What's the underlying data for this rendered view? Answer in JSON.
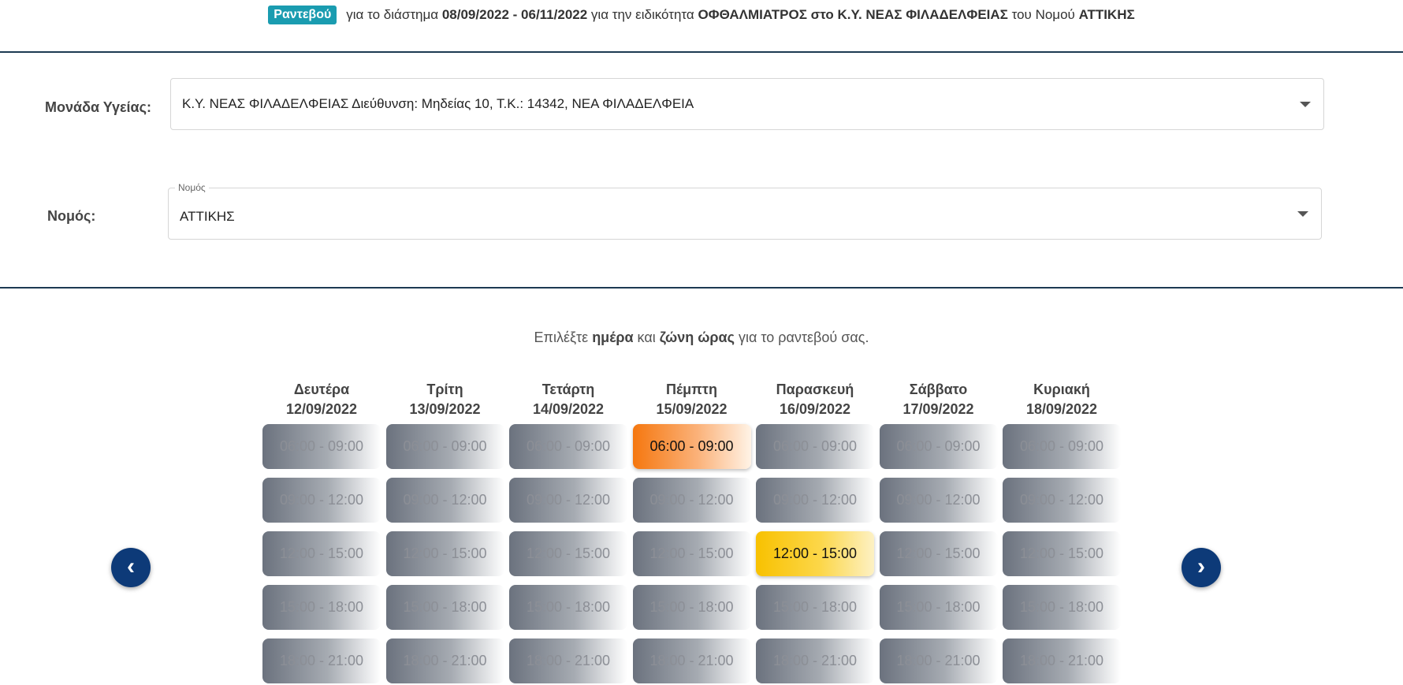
{
  "header": {
    "badge": "Ραντεβού",
    "t1": "για το διάστημα ",
    "period": "08/09/2022 - 06/11/2022",
    "t2": " για την ειδικότητα ",
    "specialty": "ΟΦΘΑΛΜΙΑΤΡΟΣ στο Κ.Υ. ΝΕΑΣ ΦΙΛΑΔΕΛΦΕΙΑΣ",
    "t3": " του Νομού ",
    "prefecture": "ΑΤΤΙΚΗΣ"
  },
  "form": {
    "unit_label": "Μονάδα Υγείας:",
    "unit_value": "Κ.Υ. ΝΕΑΣ ΦΙΛΑΔΕΛΦΕΙΑΣ Διεύθυνση: Μηδείας 10, Τ.Κ.: 14342, ΝΕΑ ΦΙΛΑΔΕΛΦΕΙΑ",
    "prefecture_label": "Νομός:",
    "prefecture_float_label": "Νομός",
    "prefecture_value": "ΑΤΤΙΚΗΣ"
  },
  "instructions": {
    "p1": "Επιλέξτε ",
    "day": "ημέρα",
    "p2": " και ",
    "zone": "ζώνη ώρας",
    "p3": " για το ραντεβού σας."
  },
  "nav": {
    "prev_icon": "chevron-left-icon",
    "next_icon": "chevron-right-icon",
    "prev": "‹",
    "next": "›"
  },
  "colors": {
    "accent": "#1a9cb0",
    "nav": "#0d3a78",
    "available": "#f5770f",
    "selected": "#f8c100",
    "divider": "#1d3a52"
  },
  "days": [
    {
      "name": "Δευτέρα",
      "date": "12/09/2022",
      "slots": [
        {
          "label": "06:00 - 09:00",
          "state": "unavailable"
        },
        {
          "label": "09:00 - 12:00",
          "state": "unavailable"
        },
        {
          "label": "12:00 - 15:00",
          "state": "unavailable"
        },
        {
          "label": "15:00 - 18:00",
          "state": "unavailable"
        },
        {
          "label": "18:00 - 21:00",
          "state": "unavailable"
        }
      ]
    },
    {
      "name": "Τρίτη",
      "date": "13/09/2022",
      "slots": [
        {
          "label": "06:00 - 09:00",
          "state": "unavailable"
        },
        {
          "label": "09:00 - 12:00",
          "state": "unavailable"
        },
        {
          "label": "12:00 - 15:00",
          "state": "unavailable"
        },
        {
          "label": "15:00 - 18:00",
          "state": "unavailable"
        },
        {
          "label": "18:00 - 21:00",
          "state": "unavailable"
        }
      ]
    },
    {
      "name": "Τετάρτη",
      "date": "14/09/2022",
      "slots": [
        {
          "label": "06:00 - 09:00",
          "state": "unavailable"
        },
        {
          "label": "09:00 - 12:00",
          "state": "unavailable"
        },
        {
          "label": "12:00 - 15:00",
          "state": "unavailable"
        },
        {
          "label": "15:00 - 18:00",
          "state": "unavailable"
        },
        {
          "label": "18:00 - 21:00",
          "state": "unavailable"
        }
      ]
    },
    {
      "name": "Πέμπτη",
      "date": "15/09/2022",
      "slots": [
        {
          "label": "06:00 - 09:00",
          "state": "orange"
        },
        {
          "label": "09:00 - 12:00",
          "state": "unavailable"
        },
        {
          "label": "12:00 - 15:00",
          "state": "unavailable"
        },
        {
          "label": "15:00 - 18:00",
          "state": "unavailable"
        },
        {
          "label": "18:00 - 21:00",
          "state": "unavailable"
        }
      ]
    },
    {
      "name": "Παρασκευή",
      "date": "16/09/2022",
      "slots": [
        {
          "label": "06:00 - 09:00",
          "state": "unavailable"
        },
        {
          "label": "09:00 - 12:00",
          "state": "unavailable"
        },
        {
          "label": "12:00 - 15:00",
          "state": "yellow"
        },
        {
          "label": "15:00 - 18:00",
          "state": "unavailable"
        },
        {
          "label": "18:00 - 21:00",
          "state": "unavailable"
        }
      ]
    },
    {
      "name": "Σάββατο",
      "date": "17/09/2022",
      "slots": [
        {
          "label": "06:00 - 09:00",
          "state": "unavailable"
        },
        {
          "label": "09:00 - 12:00",
          "state": "unavailable"
        },
        {
          "label": "12:00 - 15:00",
          "state": "unavailable"
        },
        {
          "label": "15:00 - 18:00",
          "state": "unavailable"
        },
        {
          "label": "18:00 - 21:00",
          "state": "unavailable"
        }
      ]
    },
    {
      "name": "Κυριακή",
      "date": "18/09/2022",
      "slots": [
        {
          "label": "06:00 - 09:00",
          "state": "unavailable"
        },
        {
          "label": "09:00 - 12:00",
          "state": "unavailable"
        },
        {
          "label": "12:00 - 15:00",
          "state": "unavailable"
        },
        {
          "label": "15:00 - 18:00",
          "state": "unavailable"
        },
        {
          "label": "18:00 - 21:00",
          "state": "unavailable"
        }
      ]
    }
  ]
}
